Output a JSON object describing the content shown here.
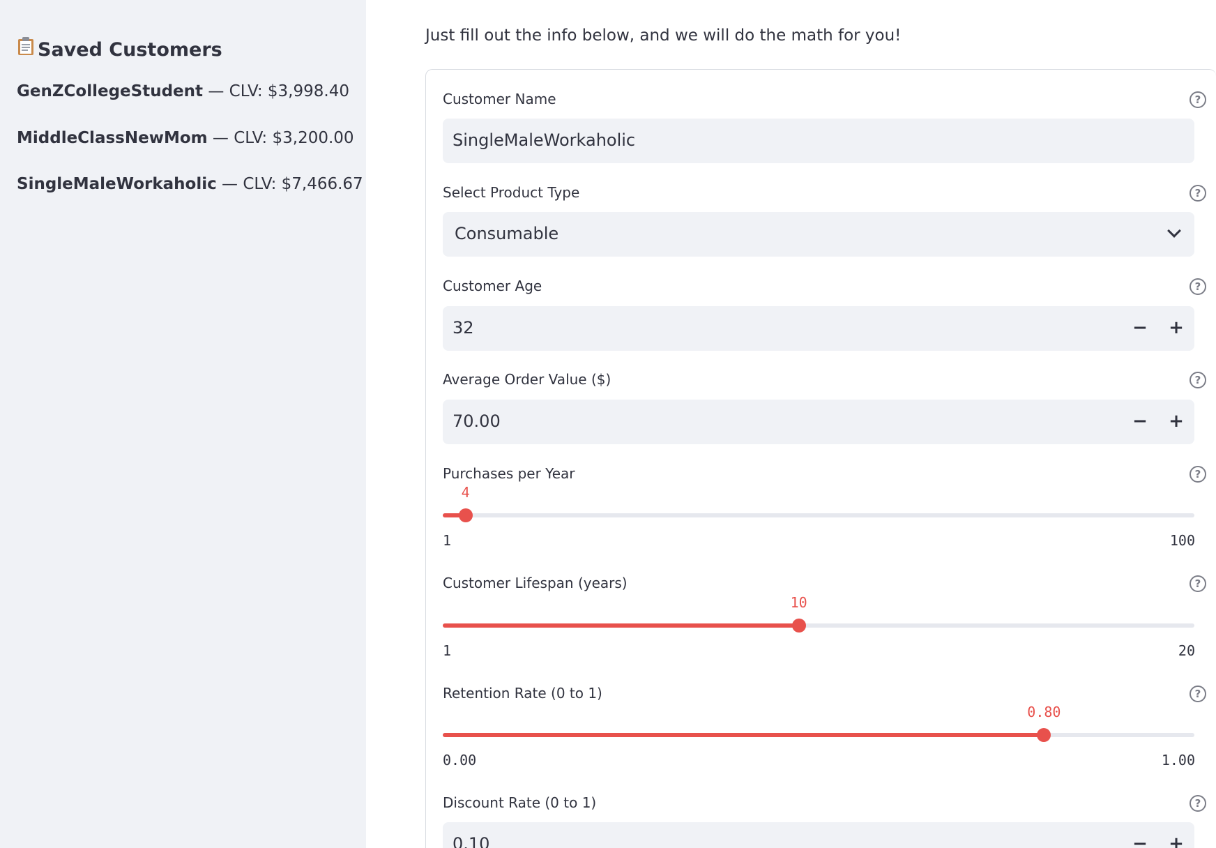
{
  "sidebar": {
    "icon": "clipboard-icon",
    "title": "Saved Customers",
    "customers": [
      {
        "name": "GenZCollegeStudent",
        "clv": " — CLV: $3,998.40"
      },
      {
        "name": "MiddleClassNewMom",
        "clv": " — CLV: $3,200.00"
      },
      {
        "name": "SingleMaleWorkaholic",
        "clv": " — CLV: $7,466.67"
      }
    ]
  },
  "main": {
    "intro": "Just fill out the info below, and we will do the math for you!"
  },
  "form": {
    "customer_name": {
      "label": "Customer Name",
      "value": "SingleMaleWorkaholic"
    },
    "product_type": {
      "label": "Select Product Type",
      "value": "Consumable"
    },
    "customer_age": {
      "label": "Customer Age",
      "value": "32"
    },
    "avg_order_value": {
      "label": "Average Order Value ($)",
      "value": "70.00"
    },
    "purchases_per_year": {
      "label": "Purchases per Year",
      "value": "4",
      "min": "1",
      "max": "100",
      "fraction": 0.0303
    },
    "lifespan": {
      "label": "Customer Lifespan (years)",
      "value": "10",
      "min": "1",
      "max": "20",
      "fraction": 0.4737
    },
    "retention": {
      "label": "Retention Rate (0 to 1)",
      "value": "0.80",
      "min": "0.00",
      "max": "1.00",
      "fraction": 0.8
    },
    "discount": {
      "label": "Discount Rate (0 to 1)",
      "value": "0.10"
    },
    "help_glyph": "?",
    "minus_glyph": "−",
    "plus_glyph": "+"
  },
  "colors": {
    "accent": "#e8514c",
    "sidebar_bg": "#f0f2f6",
    "input_bg": "#f0f2f6",
    "text": "#31333f"
  }
}
